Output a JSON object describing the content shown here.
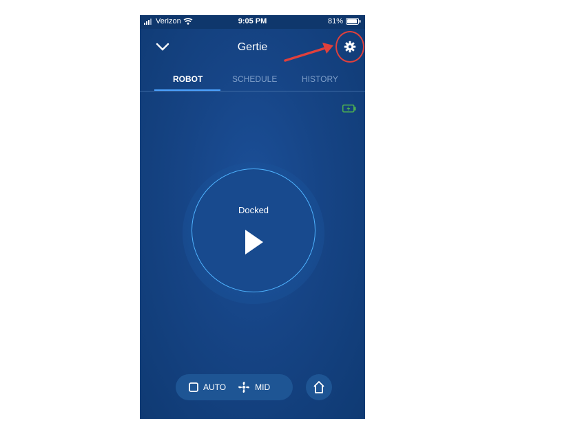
{
  "status_bar": {
    "carrier": "Verizon",
    "time": "9:05 PM",
    "battery": "81%"
  },
  "header": {
    "title": "Gertie"
  },
  "tabs": [
    {
      "label": "ROBOT"
    },
    {
      "label": "SCHEDULE"
    },
    {
      "label": "HISTORY"
    }
  ],
  "robot": {
    "status": "Docked"
  },
  "controls": {
    "mode_label": "AUTO",
    "power_label": "MID"
  },
  "annotation": {
    "color": "#e0403c"
  },
  "colors": {
    "accent": "#4da3ff",
    "battery_green": "#4caf50"
  }
}
